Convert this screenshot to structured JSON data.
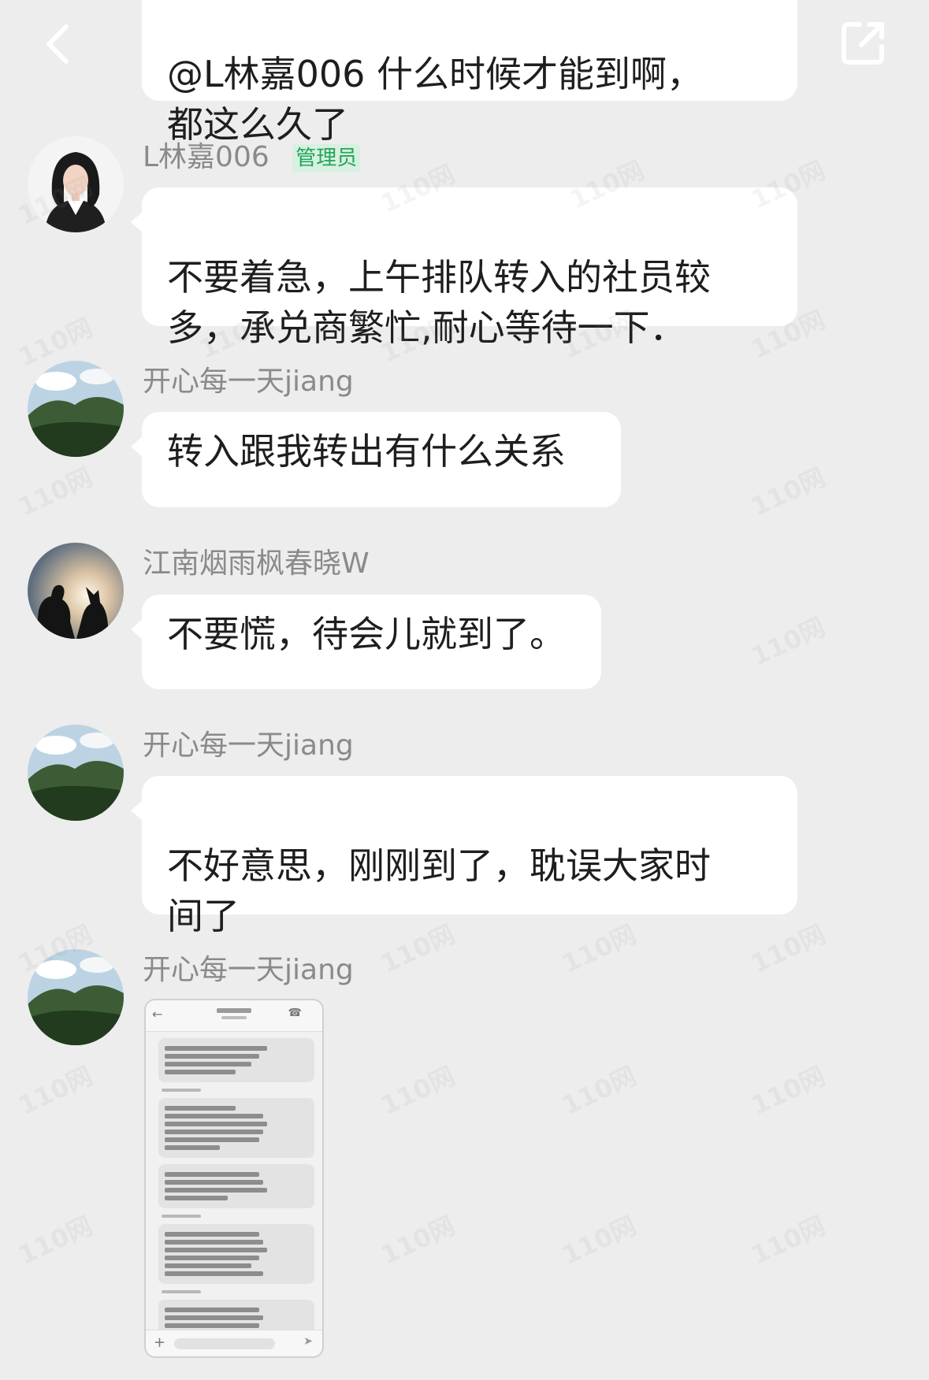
{
  "header": {
    "back_icon": "chevron-left-icon",
    "share_icon": "external-link-icon"
  },
  "messages": [
    {
      "text": "@L林嘉006 什么时候才能到啊，\n都这么久了"
    },
    {
      "sender": "L林嘉006",
      "role": "管理员",
      "text": "不要着急，上午排队转入的社员较\n多，承兑商繁忙,耐心等待一下．"
    },
    {
      "sender": "开心每一天jiang",
      "text": "转入跟我转出有什么关系"
    },
    {
      "sender": "江南烟雨枫春晓W",
      "text": "不要慌，待会儿就到了。"
    },
    {
      "sender": "开心每一天jiang",
      "text": "不好意思，刚刚到了，耽误大家时\n间了"
    },
    {
      "sender": "开心每一天jiang",
      "image": "sms-screenshot"
    }
  ],
  "watermark": "110网",
  "colors": {
    "background": "#ededed",
    "bubble": "#ffffff",
    "admin_badge": "#21a65a"
  }
}
